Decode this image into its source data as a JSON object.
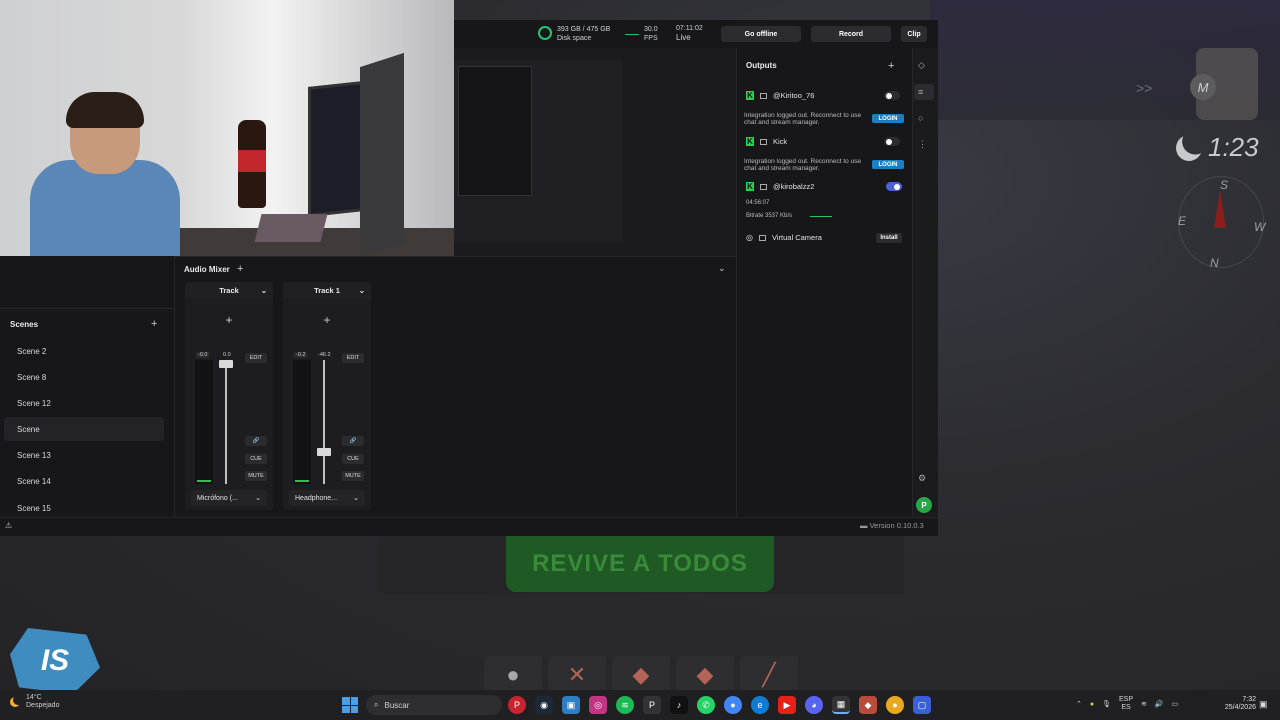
{
  "top": {
    "disk_value": "393 GB / 475 GB",
    "disk_label": "Disk space",
    "fps_value": "30.0",
    "fps_label": "FPS",
    "time_value": "07:11:02",
    "time_label": "Live",
    "disk_used_fraction": 0.83,
    "go_offline": "Go offline",
    "record": "Record",
    "clip": "Clip"
  },
  "outputs": {
    "title": "Outputs",
    "items": [
      {
        "name": "@Kiritoo_76",
        "enabled": false,
        "warning": "Integration logged out. Reconnect to use chat and stream manager.",
        "login": "LOGIN"
      },
      {
        "name": "Kick",
        "enabled": false,
        "warning": "Integration logged out. Reconnect to use chat and stream manager.",
        "login": "LOGIN"
      },
      {
        "name": "@kirobalzz2",
        "enabled": true,
        "uptime": "04:56:07",
        "bitrate": "Bitrate  3537 Kb/s"
      }
    ],
    "virtual_camera": "Virtual Camera",
    "install": "Install"
  },
  "scenes": {
    "title": "Scenes",
    "items": [
      "Scene 2",
      "Scene 8",
      "Scene 12",
      "Scene",
      "Scene 13",
      "Scene 14",
      "Scene 15"
    ],
    "active_index": 3
  },
  "mixer": {
    "title": "Audio Mixer",
    "channels": [
      {
        "track": "Track",
        "db_meter": "-0.0",
        "db_fader": "0.0",
        "edit": "EDIT",
        "cue": "CUE",
        "mute": "MUTE",
        "source": "Micrófono (..."
      },
      {
        "track": "Track 1",
        "db_meter": "-0.2",
        "db_fader": "-46.2",
        "edit": "EDIT",
        "cue": "CUE",
        "mute": "MUTE",
        "source": "Headphone..."
      }
    ]
  },
  "version": "Version 0.10.0.3",
  "game": {
    "timer": "1:23",
    "map_letter": "M",
    "compass": {
      "s": "S",
      "e": "E",
      "w": "W",
      "n": "N"
    },
    "revive": "REVIVE A TODOS",
    "logo": "IS"
  },
  "taskbar": {
    "temp": "14°C",
    "weather": "Despejado",
    "search": "Buscar",
    "lang1": "ESP",
    "lang2": "ES",
    "time": "7:32",
    "date": "25/4/2026"
  },
  "colors": {
    "accent_green": "#27c46b",
    "login_blue": "#1b7fc4",
    "toggle_on": "#4c62d8",
    "kick_green": "#27d24b"
  }
}
